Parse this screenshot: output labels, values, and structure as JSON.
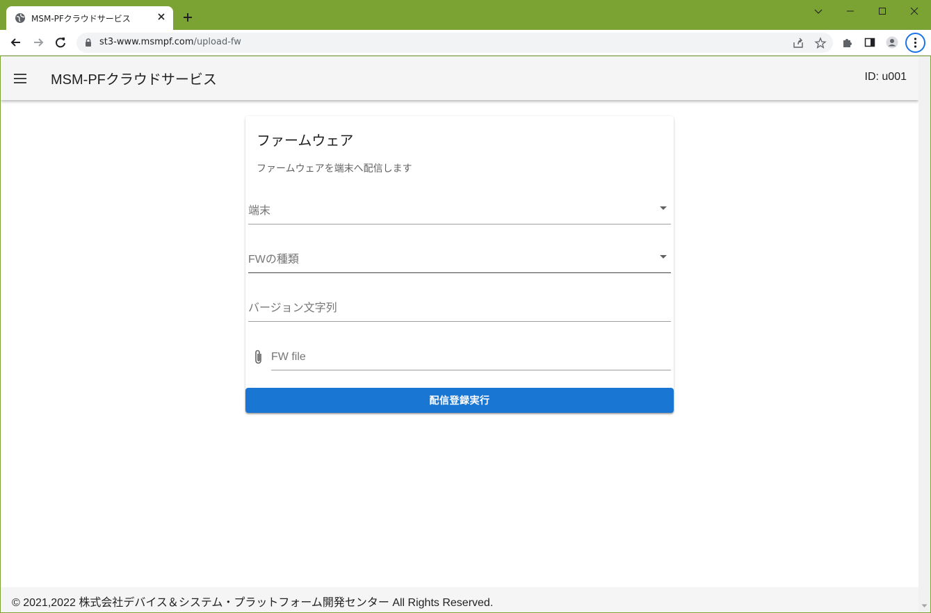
{
  "browser": {
    "tab_title": "MSM-PFクラウドサービス",
    "url_host": "st3-www.msmpf.com",
    "url_path": "/upload-fw"
  },
  "header": {
    "title": "MSM-PFクラウドサービス",
    "user_id": "ID: u001"
  },
  "card": {
    "title": "ファームウェア",
    "subtitle": "ファームウェアを端末へ配信します",
    "fields": {
      "device": {
        "label": "端末"
      },
      "fw_type": {
        "label": "FWの種類"
      },
      "version": {
        "label": "バージョン文字列"
      },
      "fw_file": {
        "label": "FW file"
      }
    },
    "submit_label": "配信登録実行"
  },
  "footer": {
    "text": "© 2021,2022 株式会社デバイス＆システム・プラットフォーム開発センター All Rights Reserved."
  },
  "colors": {
    "frame": "#7aa334",
    "primary": "#1976d2",
    "focus_ring": "#1a73e8"
  },
  "icons": [
    "globe-icon",
    "close-icon",
    "plus-icon",
    "chevron-down-icon",
    "minimize-icon",
    "maximize-icon",
    "window-close-icon",
    "back-icon",
    "forward-icon",
    "reload-icon",
    "lock-icon",
    "share-icon",
    "star-icon",
    "extensions-icon",
    "side-panel-icon",
    "profile-icon",
    "more-vert-icon",
    "menu-icon",
    "paperclip-icon"
  ]
}
